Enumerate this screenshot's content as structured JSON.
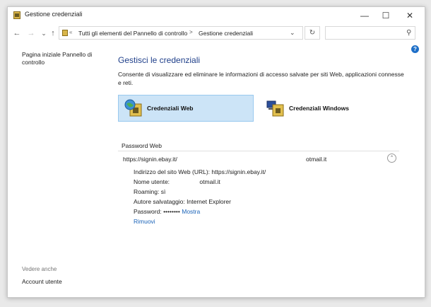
{
  "window": {
    "title": "Gestione credenziali",
    "minimize_glyph": "—",
    "maximize_glyph": "☐",
    "close_glyph": "✕"
  },
  "addressbar": {
    "back_glyph": "←",
    "forward_glyph": "→",
    "recent_glyph": "⌄",
    "up_glyph": "↑",
    "separator": "«",
    "crumbs": [
      "Tutti gli elementi del Pannello di controllo",
      "Gestione credenziali"
    ],
    "crumb_chevron": ">",
    "dropdown_glyph": "⌄",
    "refresh_glyph": "↻",
    "search_glyph": "⚲"
  },
  "help_glyph": "?",
  "sidebar": {
    "home_link": "Pagina iniziale Pannello di controllo",
    "see_also": "Vedere anche",
    "account_link": "Account utente"
  },
  "main": {
    "heading": "Gestisci le credenziali",
    "description": "Consente di visualizzare ed eliminare le informazioni di accesso salvate per siti Web, applicazioni connesse e reti.",
    "tiles": [
      {
        "label": "Credenziali Web",
        "icon": "web-credentials-icon",
        "selected": true
      },
      {
        "label": "Credenziali Windows",
        "icon": "windows-credentials-icon",
        "selected": false
      }
    ],
    "section_title": "Password Web",
    "entry": {
      "url": "https://signin.ebay.it/",
      "user_short": "otmail.it",
      "collapse_glyph": "⌃",
      "details": {
        "site_label": "Indirizzo del sito Web (URL):",
        "site_value": "https://signin.ebay.it/",
        "user_label": "Nome utente:",
        "user_value": "otmail.it",
        "roaming_label": "Roaming:",
        "roaming_value": "sì",
        "author_label": "Autore salvataggio:",
        "author_value": "Internet Explorer",
        "password_label": "Password:",
        "password_value": "••••••••",
        "show_link": "Mostra",
        "remove_link": "Rimuovi"
      }
    }
  },
  "colors": {
    "heading": "#1f3f8a",
    "link": "#1a63b8",
    "tile_selected_bg": "#cce4f7",
    "tile_selected_border": "#99c9ef"
  }
}
